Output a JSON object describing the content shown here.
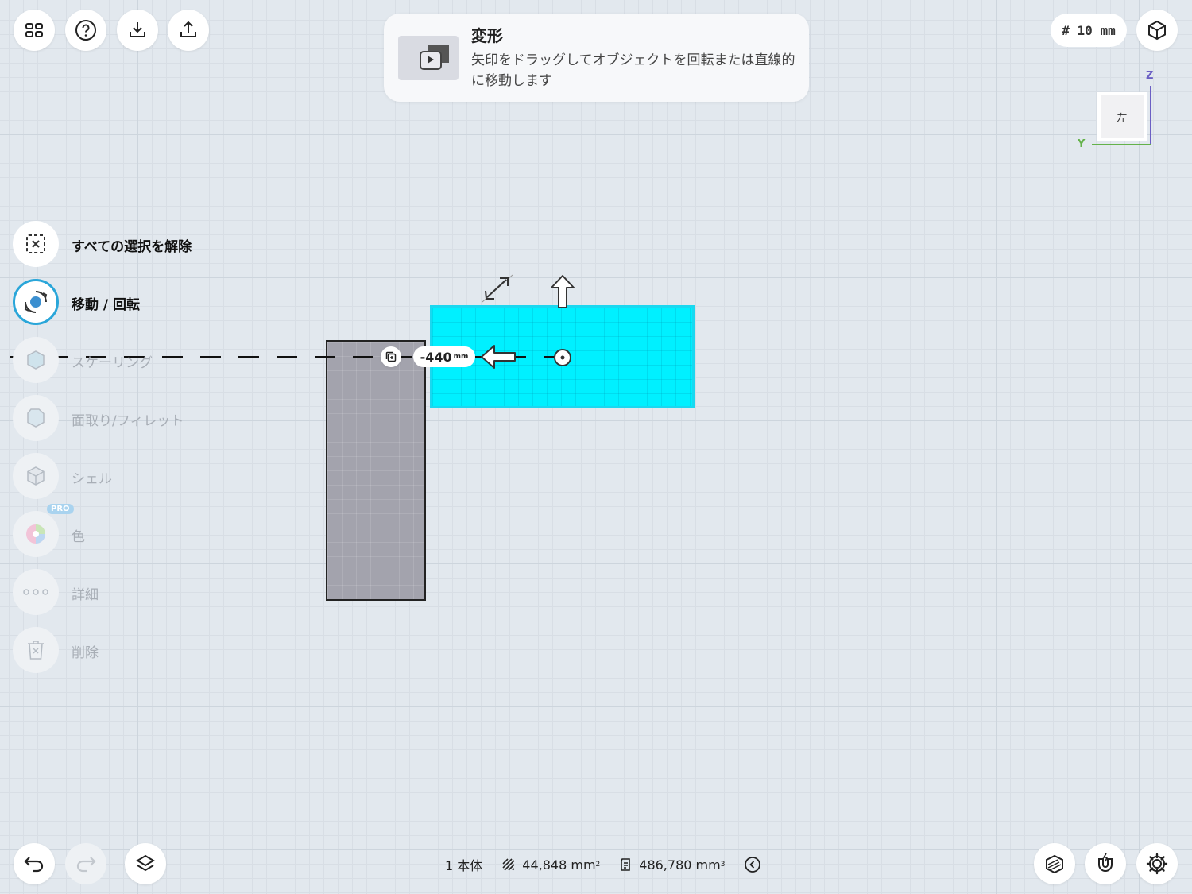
{
  "toolbar_top": {
    "grid_size_label": "# 10 mm"
  },
  "tooltip": {
    "title": "変形",
    "description": "矢印をドラッグしてオブジェクトを回転または直線的に移動します"
  },
  "viewcube": {
    "face_label": "左",
    "axis_z": "Z",
    "axis_y": "Y"
  },
  "tools": [
    {
      "label": "すべての選択を解除",
      "state": "enabled"
    },
    {
      "label": "移動 / 回転",
      "state": "active"
    },
    {
      "label": "スケーリング",
      "state": "disabled"
    },
    {
      "label": "面取り/フィレット",
      "state": "disabled"
    },
    {
      "label": "シェル",
      "state": "disabled"
    },
    {
      "label": "色",
      "state": "disabled",
      "badge": "PRO"
    },
    {
      "label": "詳細",
      "state": "disabled"
    },
    {
      "label": "削除",
      "state": "disabled"
    }
  ],
  "manipulator": {
    "distance_value": "-440",
    "distance_unit": "mm"
  },
  "status_bar": {
    "bodies": "1 本体",
    "area_value": "44,848 mm",
    "area_sup": "2",
    "volume_value": "486,780 mm",
    "volume_sup": "3"
  },
  "colors": {
    "selected_body": "#00f0ff",
    "other_body": "#a3a3ad",
    "accent": "#2aa6d9"
  }
}
